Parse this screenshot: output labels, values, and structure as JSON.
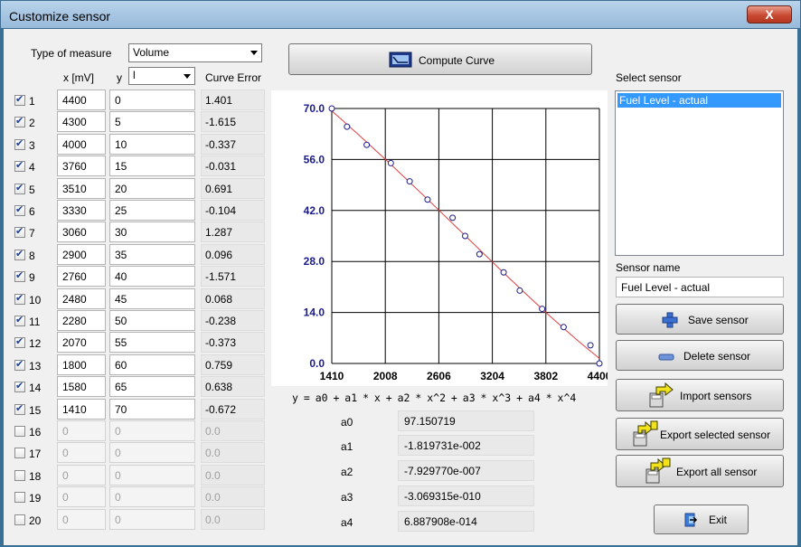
{
  "window": {
    "title": "Customize sensor",
    "close_glyph": "X"
  },
  "measure": {
    "label": "Type of measure",
    "value": "Volume"
  },
  "headers": {
    "x": "x [mV]",
    "y": "y",
    "y_unit": "l",
    "error": "Curve Error"
  },
  "rows": [
    {
      "n": "1",
      "checked": true,
      "x": "4400",
      "y": "0",
      "err": "1.401"
    },
    {
      "n": "2",
      "checked": true,
      "x": "4300",
      "y": "5",
      "err": "-1.615"
    },
    {
      "n": "3",
      "checked": true,
      "x": "4000",
      "y": "10",
      "err": "-0.337"
    },
    {
      "n": "4",
      "checked": true,
      "x": "3760",
      "y": "15",
      "err": "-0.031"
    },
    {
      "n": "5",
      "checked": true,
      "x": "3510",
      "y": "20",
      "err": "0.691"
    },
    {
      "n": "6",
      "checked": true,
      "x": "3330",
      "y": "25",
      "err": "-0.104"
    },
    {
      "n": "7",
      "checked": true,
      "x": "3060",
      "y": "30",
      "err": "1.287"
    },
    {
      "n": "8",
      "checked": true,
      "x": "2900",
      "y": "35",
      "err": "0.096"
    },
    {
      "n": "9",
      "checked": true,
      "x": "2760",
      "y": "40",
      "err": "-1.571"
    },
    {
      "n": "10",
      "checked": true,
      "x": "2480",
      "y": "45",
      "err": "0.068"
    },
    {
      "n": "11",
      "checked": true,
      "x": "2280",
      "y": "50",
      "err": "-0.238"
    },
    {
      "n": "12",
      "checked": true,
      "x": "2070",
      "y": "55",
      "err": "-0.373"
    },
    {
      "n": "13",
      "checked": true,
      "x": "1800",
      "y": "60",
      "err": "0.759"
    },
    {
      "n": "14",
      "checked": true,
      "x": "1580",
      "y": "65",
      "err": "0.638"
    },
    {
      "n": "15",
      "checked": true,
      "x": "1410",
      "y": "70",
      "err": "-0.672"
    },
    {
      "n": "16",
      "checked": false,
      "x": "0",
      "y": "0",
      "err": "0.0"
    },
    {
      "n": "17",
      "checked": false,
      "x": "0",
      "y": "0",
      "err": "0.0"
    },
    {
      "n": "18",
      "checked": false,
      "x": "0",
      "y": "0",
      "err": "0.0"
    },
    {
      "n": "19",
      "checked": false,
      "x": "0",
      "y": "0",
      "err": "0.0"
    },
    {
      "n": "20",
      "checked": false,
      "x": "0",
      "y": "0",
      "err": "0.0"
    }
  ],
  "compute_button": "Compute Curve",
  "formula": "y = a0 + a1 * x + a2 * x^2 + a3 * x^3 + a4 * x^4",
  "coefficients": [
    {
      "name": "a0",
      "value": "97.150719"
    },
    {
      "name": "a1",
      "value": "-1.819731e-002"
    },
    {
      "name": "a2",
      "value": "-7.929770e-007"
    },
    {
      "name": "a3",
      "value": "-3.069315e-010"
    },
    {
      "name": "a4",
      "value": "6.887908e-014"
    }
  ],
  "select_sensor": {
    "label": "Select sensor",
    "items": [
      "Fuel Level - actual"
    ],
    "selected": 0
  },
  "sensor_name": {
    "label": "Sensor name",
    "value": "Fuel Level - actual"
  },
  "buttons": {
    "save": "Save sensor",
    "delete": "Delete sensor",
    "import": "Import sensors",
    "export_selected": "Export selected sensor",
    "export_all": "Export all sensor",
    "exit": "Exit"
  },
  "chart_data": {
    "type": "scatter",
    "xlim": [
      1410,
      4400
    ],
    "ylim": [
      0,
      70
    ],
    "x_ticks": [
      "1410",
      "2008",
      "2606",
      "3204",
      "3802",
      "4400"
    ],
    "y_ticks": [
      "0.0",
      "14.0",
      "28.0",
      "42.0",
      "56.0",
      "70.0"
    ],
    "points": [
      {
        "x": 4400,
        "y": 0
      },
      {
        "x": 4300,
        "y": 5
      },
      {
        "x": 4000,
        "y": 10
      },
      {
        "x": 3760,
        "y": 15
      },
      {
        "x": 3510,
        "y": 20
      },
      {
        "x": 3330,
        "y": 25
      },
      {
        "x": 3060,
        "y": 30
      },
      {
        "x": 2900,
        "y": 35
      },
      {
        "x": 2760,
        "y": 40
      },
      {
        "x": 2480,
        "y": 45
      },
      {
        "x": 2280,
        "y": 50
      },
      {
        "x": 2070,
        "y": 55
      },
      {
        "x": 1800,
        "y": 60
      },
      {
        "x": 1580,
        "y": 65
      },
      {
        "x": 1410,
        "y": 70
      }
    ],
    "curve": {
      "a0": 97.150719,
      "a1": -0.01819731,
      "a2": -7.92977e-07,
      "a3": -3.069315e-10,
      "a4": 6.887908e-14
    },
    "colors": {
      "curve": "#e04040",
      "points": "#1a1a8c",
      "axis_labels": "#1a1a8c"
    },
    "grid": true
  }
}
